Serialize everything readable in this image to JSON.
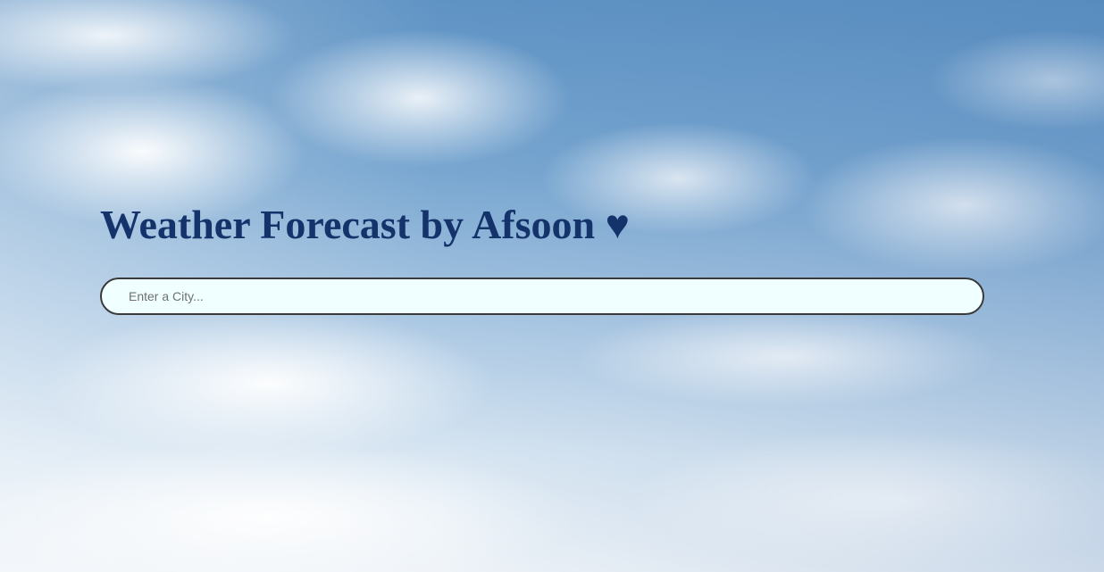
{
  "header": {
    "title": "Weather Forecast by Afsoon ♥"
  },
  "search": {
    "placeholder": "Enter a City...",
    "value": ""
  },
  "background": {
    "description_color": "#78a6d0"
  },
  "colors": {
    "title": "#15336b",
    "input_background": "#f0ffff",
    "input_border": "#3a3a3a"
  }
}
